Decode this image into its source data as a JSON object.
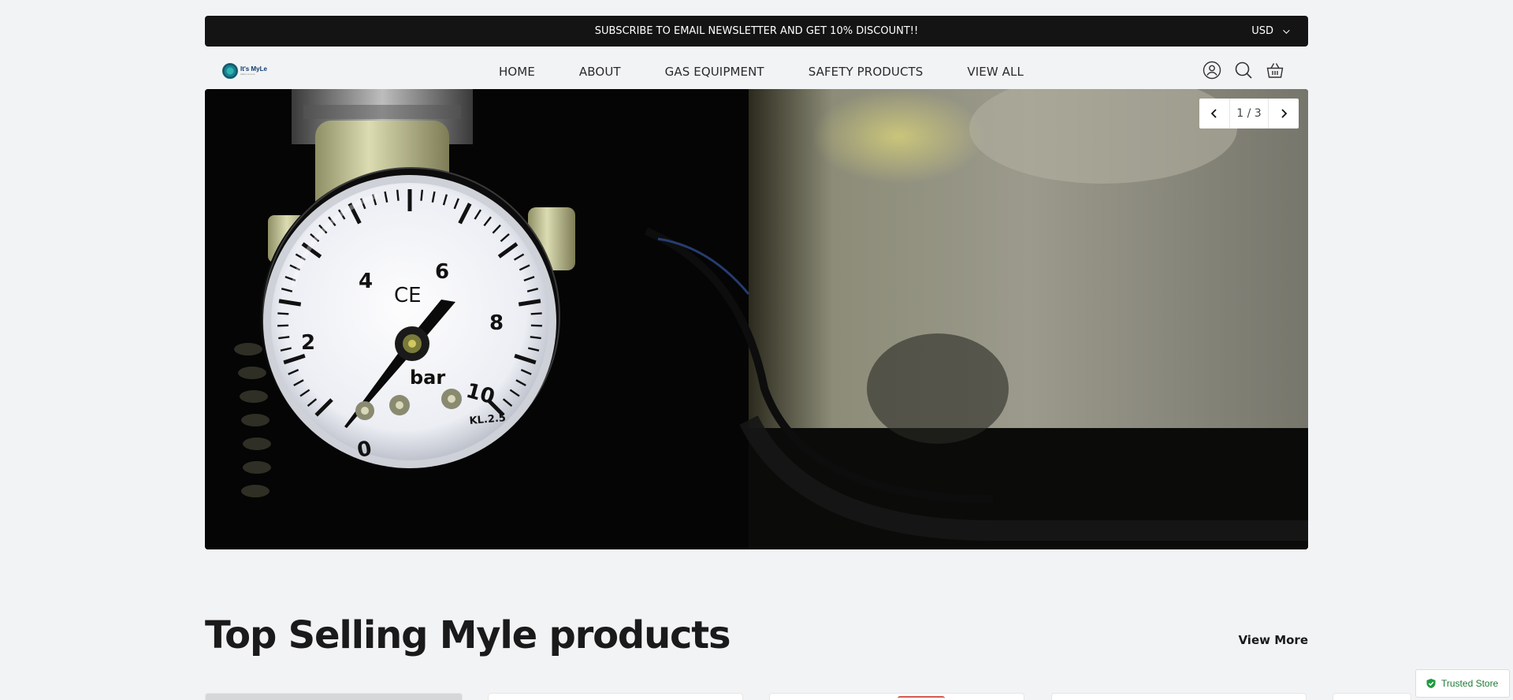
{
  "announcement": {
    "text": "SUBSCRIBE TO  EMAIL  NEWSLETTER AND GET 10%  DISCOUNT!!",
    "currency": "USD"
  },
  "brand": {
    "logo_line1": "It's MyLe",
    "logo_line2": "safety & more"
  },
  "nav": {
    "items": [
      "HOME",
      "ABOUT",
      "GAS  EQUIPMENT",
      "SAFETY  PRODUCTS",
      "VIEW ALL"
    ]
  },
  "header_icons": [
    "account-icon",
    "search-icon",
    "cart-icon"
  ],
  "hero": {
    "slide_counter": "1 / 3",
    "image_description_icon": "pressure-gauge-image",
    "gauge_labels": [
      "0",
      "2",
      "4",
      "6",
      "8",
      "10"
    ],
    "gauge_unit": "bar",
    "gauge_mark": "CE",
    "gauge_class": "KL.2.5"
  },
  "section": {
    "title": "Top Selling Myle products",
    "view_more": "View More"
  },
  "trust_badge": {
    "text": "Trusted Store",
    "color": "#1f7a35"
  }
}
